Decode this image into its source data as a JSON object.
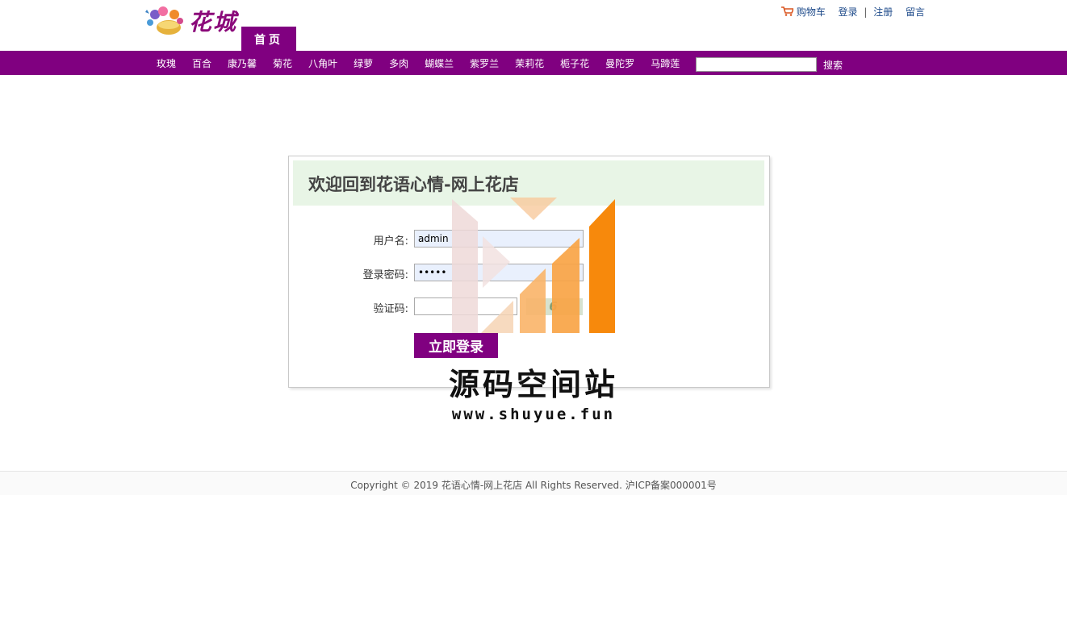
{
  "header": {
    "logo_text": "花城",
    "home_tab": "首页",
    "links": {
      "cart": "购物车",
      "login": "登录",
      "divider": "|",
      "register": "注册",
      "message": "留言"
    }
  },
  "nav": {
    "items": [
      "玫瑰",
      "百合",
      "康乃馨",
      "菊花",
      "八角叶",
      "绿萝",
      "多肉",
      "蝴蝶兰",
      "紫罗兰",
      "茉莉花",
      "栀子花",
      "曼陀罗",
      "马蹄莲"
    ],
    "search_value": "",
    "search_button": "搜索"
  },
  "login": {
    "title": "欢迎回到花语心情-网上花店",
    "username_label": "用户名:",
    "username_value": "admin",
    "password_label": "登录密码:",
    "password_value": "•••••",
    "captcha_label": "验证码:",
    "captcha_value": "",
    "captcha_image_text": "6",
    "submit": "立即登录"
  },
  "watermark": {
    "title": "源码空间站",
    "url": "www.shuyue.fun"
  },
  "footer": {
    "copyright": "Copyright © 2019 花语心情-网上花店 All Rights Reserved. 沪ICP备案000001号"
  },
  "colors": {
    "primary": "#800080",
    "header_bg": "#e8f5e6",
    "link": "#1d4a8a",
    "watermark_orange": "#f7890c"
  }
}
